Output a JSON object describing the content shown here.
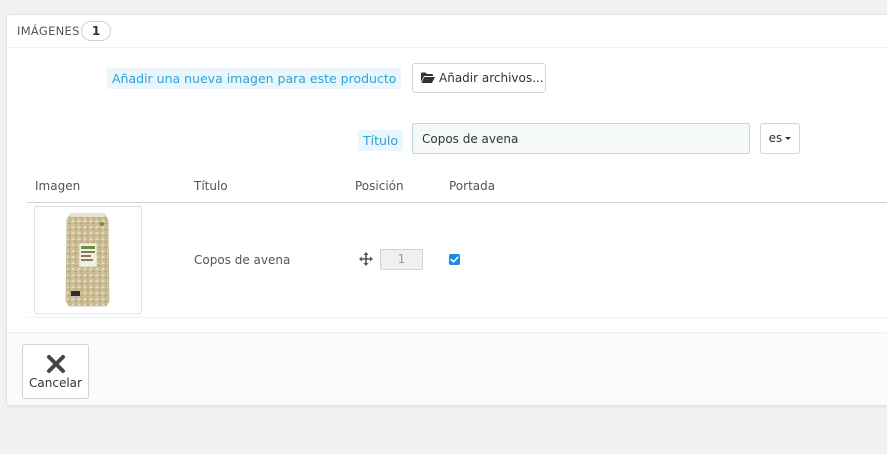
{
  "panel": {
    "title": "Imágenes",
    "count": "1"
  },
  "upload": {
    "label": "Añadir una nueva imagen para este producto",
    "button_label": "Añadir archivos..."
  },
  "title_field": {
    "label": "Título",
    "value": "Copos de avena",
    "language": "es"
  },
  "table": {
    "headers": [
      "Imagen",
      "Título",
      "Posición",
      "Portada"
    ],
    "rows": [
      {
        "title": "Copos de avena",
        "position": "1",
        "cover": true
      }
    ]
  },
  "footer": {
    "cancel_label": "Cancelar"
  },
  "colors": {
    "accent": "#2ea4d6",
    "checkbox": "#1e88e5",
    "background": "#eff1f2"
  },
  "icons": {
    "upload_button": "folder-open-icon",
    "position": "move-icon",
    "cancel": "close-icon"
  }
}
